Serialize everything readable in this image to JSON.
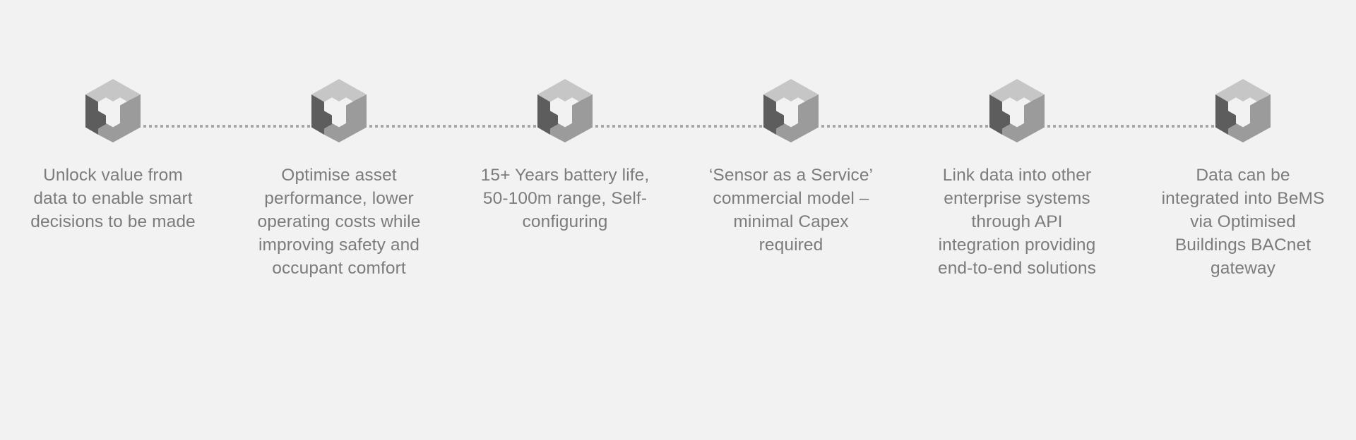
{
  "background_color": "#f2f2f2",
  "text_color": "#7c7c7c",
  "connector": {
    "name": "dotted-connector-line",
    "color": "#a9a9a9",
    "style": "dotted"
  },
  "icon": {
    "semantic_name": "isometric-cube-icon",
    "top_face_color": "#c6c6c6",
    "left_face_color": "#5d5d5d",
    "right_face_color": "#9b9b9b",
    "notch_color": "#f2f2f2"
  },
  "steps": [
    {
      "id": "step-1",
      "icon": "isometric-cube-icon",
      "text": "Unlock value from data to enable smart decisions to be made"
    },
    {
      "id": "step-2",
      "icon": "isometric-cube-icon",
      "text": "Optimise asset performance, lower operating costs while improving safety and occupant comfort"
    },
    {
      "id": "step-3",
      "icon": "isometric-cube-icon",
      "text": "15+ Years battery life, 50-100m range, Self-configuring"
    },
    {
      "id": "step-4",
      "icon": "isometric-cube-icon",
      "text": "‘Sensor as a Service’ commercial model – minimal Capex required"
    },
    {
      "id": "step-5",
      "icon": "isometric-cube-icon",
      "text": "Link data into other enterprise systems through API integration providing end-to-end solutions"
    },
    {
      "id": "step-6",
      "icon": "isometric-cube-icon",
      "text": "Data can be integrated into BeMS via Optimised Buildings BACnet gateway"
    }
  ]
}
